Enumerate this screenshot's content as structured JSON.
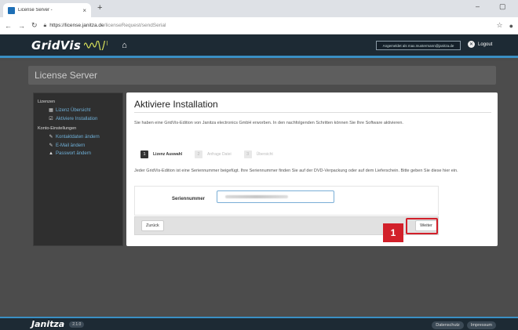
{
  "browser": {
    "tab_title": "License Server -",
    "tab_close": "×",
    "new_tab": "+",
    "url_host": "https://license.janitza.de",
    "url_path": "/licenseRequest/sendSerial",
    "min": "–",
    "max": "▢"
  },
  "header": {
    "logo": "GridVis",
    "user_text": "Angemeldet als max.mustermann@janitza.de",
    "logout_label": "Logout"
  },
  "panel": {
    "title": "License Server"
  },
  "sidebar": {
    "section1": "Lizenzen",
    "items1": [
      {
        "label": "Lizenz Übersicht"
      },
      {
        "label": "Aktiviere Installation"
      }
    ],
    "section2": "Konto-Einstellungen",
    "items2": [
      {
        "label": "Kontaktdaten ändern"
      },
      {
        "label": "E-Mail ändern"
      },
      {
        "label": "Passwort ändern"
      }
    ]
  },
  "content": {
    "title": "Aktiviere Installation",
    "intro": "Sie haben eine GridVis-Edition von Janitza electronics GmbH erworben. In den nachfolgenden Schritten können Sie Ihre Software aktivieren.",
    "steps": [
      {
        "num": "1",
        "label": "Lizenz Auswahl"
      },
      {
        "num": "2",
        "label": "Anfrage Datei"
      },
      {
        "num": "3",
        "label": "Übersicht"
      }
    ],
    "description": "Jeder GridVis-Edition ist eine Seriennummer beigefügt. Ihre Seriennummer finden Sie auf der DVD-Verpackung oder auf dem Lieferschein. Bitte geben Sie diese hier ein.",
    "serial_label": "Seriennummer",
    "back_label": "Zurück",
    "next_label": "Weiter"
  },
  "callout": {
    "number": "1"
  },
  "footer": {
    "logo": "Janitza",
    "version": "2.1.0",
    "links": [
      {
        "label": "Datenschutz"
      },
      {
        "label": "Impressum"
      }
    ]
  },
  "colors": {
    "accent": "#3a8fc4",
    "highlight": "#d2202a",
    "header_bg": "#1d2a34"
  }
}
